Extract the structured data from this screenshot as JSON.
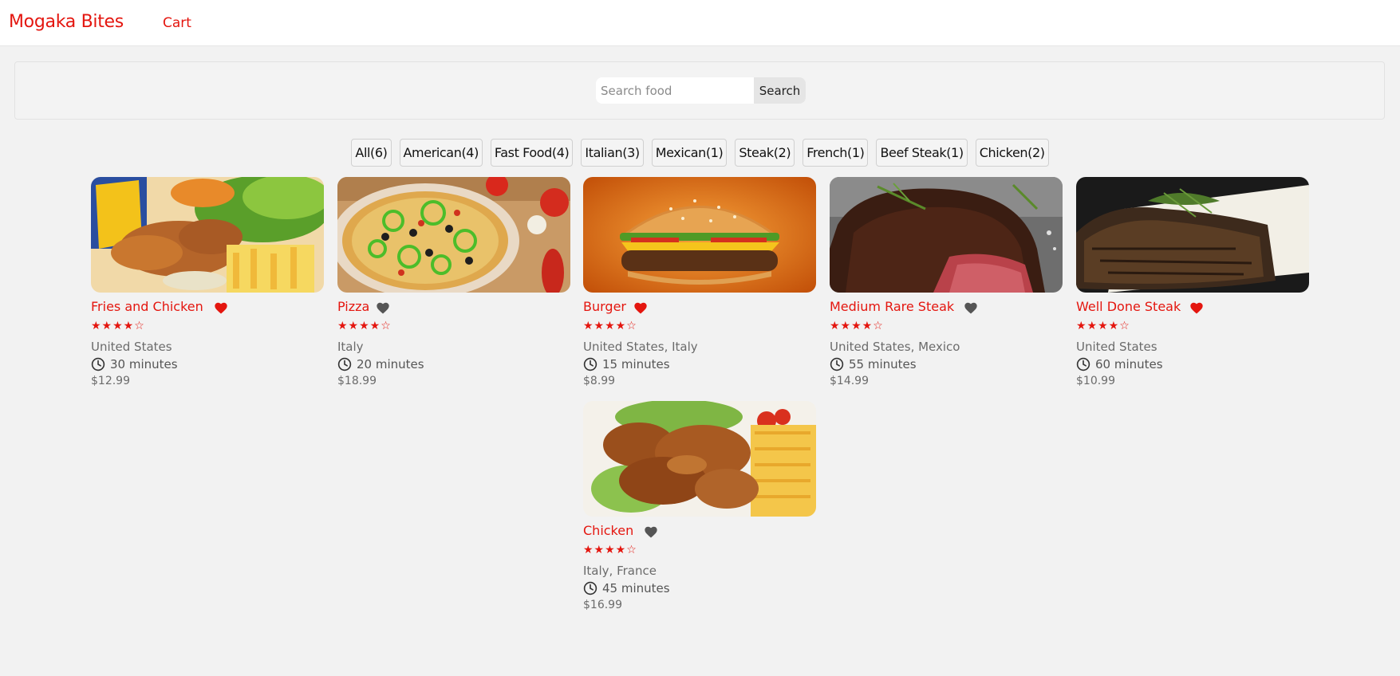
{
  "header": {
    "brand": "Mogaka Bites",
    "cart_label": "Cart"
  },
  "search": {
    "placeholder": "Search food",
    "value": "",
    "button_label": "Search"
  },
  "tags": [
    "All(6)",
    "American(4)",
    "Fast Food(4)",
    "Italian(3)",
    "Mexican(1)",
    "Steak(2)",
    "French(1)",
    "Beef Steak(1)",
    "Chicken(2)"
  ],
  "colors": {
    "accent": "#e4160f",
    "favorite_on": "#e4160f",
    "favorite_off": "#555555"
  },
  "foods": [
    {
      "name": "Fries and Chicken",
      "favorite": true,
      "stars": 4,
      "star_text": "★★★★☆",
      "origins": "United States",
      "cook_time": "30 minutes",
      "price": "$12.99",
      "image": "fries-and-chicken-photo"
    },
    {
      "name": "Pizza",
      "favorite": false,
      "stars": 4,
      "star_text": "★★★★☆",
      "origins": "Italy",
      "cook_time": "20 minutes",
      "price": "$18.99",
      "image": "pizza-photo"
    },
    {
      "name": "Burger",
      "favorite": true,
      "stars": 4,
      "star_text": "★★★★☆",
      "origins": "United States, Italy",
      "cook_time": "15 minutes",
      "price": "$8.99",
      "image": "burger-photo"
    },
    {
      "name": "Medium Rare Steak",
      "favorite": false,
      "stars": 4,
      "star_text": "★★★★☆",
      "origins": "United States, Mexico",
      "cook_time": "55 minutes",
      "price": "$14.99",
      "image": "medium-rare-steak-photo"
    },
    {
      "name": "Well Done Steak",
      "favorite": true,
      "stars": 4,
      "star_text": "★★★★☆",
      "origins": "United States",
      "cook_time": "60 minutes",
      "price": "$10.99",
      "image": "well-done-steak-photo"
    },
    {
      "name": "Chicken",
      "favorite": false,
      "stars": 4,
      "star_text": "★★★★☆",
      "origins": "Italy, France",
      "cook_time": "45 minutes",
      "price": "$16.99",
      "image": "chicken-photo"
    }
  ]
}
